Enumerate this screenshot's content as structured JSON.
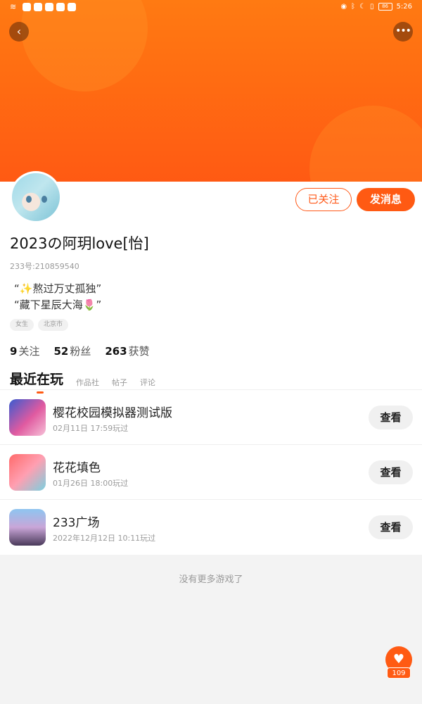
{
  "status_bar": {
    "time": "5:26",
    "battery": "86"
  },
  "header": {
    "back_icon": "‹",
    "more_icon": "•••"
  },
  "profile": {
    "nickname": "2023の阿玥love[怡]",
    "uid": "233号:210859540",
    "bio_lines": [
      "“✨熬过万丈孤独”",
      "“藏下星辰大海🌷”"
    ],
    "tags": [
      "女生",
      "北京市"
    ],
    "follow_button": "已关注",
    "message_button": "发消息"
  },
  "stats": [
    {
      "count": "9",
      "label": "关注"
    },
    {
      "count": "52",
      "label": "粉丝"
    },
    {
      "count": "263",
      "label": "获赞"
    }
  ],
  "tabs": [
    "最近在玩",
    "作品社",
    "帖子",
    "评论"
  ],
  "games": [
    {
      "name": "樱花校园模拟器测试版",
      "time": "02月11日 17:59玩过",
      "button": "查看"
    },
    {
      "name": "花花填色",
      "time": "01月26日 18:00玩过",
      "button": "查看"
    },
    {
      "name": "233广场",
      "time": "2022年12月12日 10:11玩过",
      "button": "查看"
    }
  ],
  "footer": {
    "no_more": "没有更多游戏了"
  },
  "like": {
    "count": "109"
  },
  "colors": {
    "accent": "#ff5a13",
    "banner_top": "#ff7a12"
  }
}
